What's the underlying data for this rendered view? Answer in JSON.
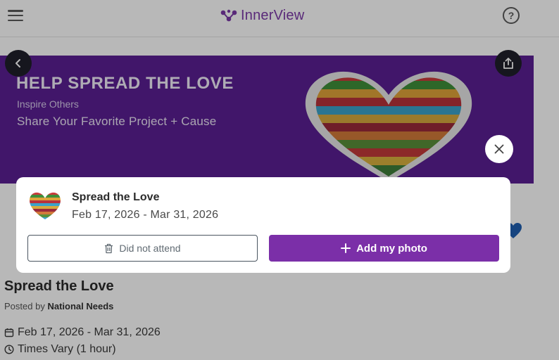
{
  "header": {
    "logo_text": "InnerView",
    "menu_icon": "hamburger-menu-icon",
    "help_icon": "help-circle-icon",
    "help_glyph": "?"
  },
  "banner": {
    "title": "HELP SPREAD THE LOVE",
    "subtitle": "Inspire Others",
    "tagline": "Share Your Favorite Project + Cause"
  },
  "colors": {
    "brand": "#7b2fa8",
    "banner_bg": "#5b1f93",
    "overlay": "rgba(0,0,0,0.28)"
  },
  "event": {
    "title": "Spread the Love",
    "posted_by_label": "Posted by",
    "posted_by": "National Needs",
    "dates": "Feb 17, 2026 - Mar 31, 2026",
    "times": "Times Vary (1 hour)"
  },
  "modal": {
    "title": "Spread the Love",
    "dates": "Feb 17, 2026 - Mar 31, 2026",
    "did_not_attend_label": "Did not attend",
    "add_photo_label": "Add my photo"
  }
}
